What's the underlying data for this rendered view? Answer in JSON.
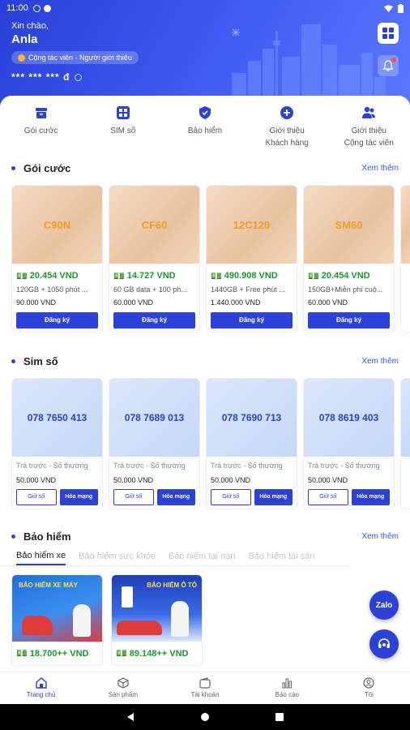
{
  "status_bar": {
    "time": "11:00"
  },
  "header": {
    "greeting": "Xin chào,",
    "user_name": "Anla",
    "role_badge": "Cộng tác viên - Người giới thiệu",
    "balance_masked": "*** *** *** đ"
  },
  "quick_actions": [
    {
      "icon": "package-icon",
      "label": "Gói cước",
      "label2": ""
    },
    {
      "icon": "sim-icon",
      "label": "SIM số",
      "label2": ""
    },
    {
      "icon": "shield-icon",
      "label": "Bảo hiểm",
      "label2": ""
    },
    {
      "icon": "plus-circle-icon",
      "label": "Giới thiệu",
      "label2": "Khách hàng"
    },
    {
      "icon": "users-icon",
      "label": "Giới thiệu",
      "label2": "Cộng tác viên"
    }
  ],
  "packages": {
    "title": "Gói cước",
    "more": "Xem thêm",
    "items": [
      {
        "code": "C90N",
        "commission": "20.454 VND",
        "desc": "120GB + 1050 phút ...",
        "price": "90.000 VND",
        "button": "Đăng ký"
      },
      {
        "code": "CF60",
        "commission": "14.727 VND",
        "desc": "60 GB data + 100 ph...",
        "price": "60.000 VND",
        "button": "Đăng ký"
      },
      {
        "code": "12C120",
        "commission": "490.908 VND",
        "desc": "1440GB + Free phút ...",
        "price": "1.440.000 VND",
        "button": "Đăng ký"
      },
      {
        "code": "SM60",
        "commission": "20.454 VND",
        "desc": "150GB+Miễn phí cuộ...",
        "price": "60.000 VND",
        "button": "Đăng ký"
      }
    ]
  },
  "sims": {
    "title": "Sim số",
    "more": "Xem thêm",
    "items": [
      {
        "number": "078 7650 413",
        "type": "Trả trước - Số thường",
        "price": "50.000 VND",
        "hold": "Giữ số",
        "connect": "Hòa mạng"
      },
      {
        "number": "078 7689 013",
        "type": "Trả trước - Số thường",
        "price": "50.000 VND",
        "hold": "Giữ số",
        "connect": "Hòa mạng"
      },
      {
        "number": "078 7690 713",
        "type": "Trả trước - Số thường",
        "price": "50.000 VND",
        "hold": "Giữ số",
        "connect": "Hòa mạng"
      },
      {
        "number": "078 8619 403",
        "type": "Trả trước - Số thường",
        "price": "50.000 VND",
        "hold": "Giữ số",
        "connect": "Hòa mạng"
      }
    ]
  },
  "insurance": {
    "title": "Bảo hiểm",
    "more": "Xem thêm",
    "tabs": [
      "Bảo hiểm xe",
      "Bảo hiểm sức khỏe",
      "Bảo hiểm tai nạn",
      "Bảo hiểm tài sản"
    ],
    "items": [
      {
        "commission": "18.700++ VND",
        "banner": "BẢO HIỂM XE MÁY"
      },
      {
        "commission": "89.148++ VND",
        "banner": "BẢO HIỂM Ô TÔ"
      }
    ]
  },
  "floating": {
    "zalo": "Zalo"
  },
  "bottom_nav": [
    {
      "icon": "home-icon",
      "label": "Trang chủ"
    },
    {
      "icon": "box-icon",
      "label": "Sản phẩm"
    },
    {
      "icon": "wallet-icon",
      "label": "Tài khoản"
    },
    {
      "icon": "chart-icon",
      "label": "Báo cáo"
    },
    {
      "icon": "user-icon",
      "label": "Tôi"
    }
  ],
  "colors": {
    "primary": "#2b41d8",
    "commission": "#1a9a2d",
    "package_code": "#f09b2b"
  }
}
